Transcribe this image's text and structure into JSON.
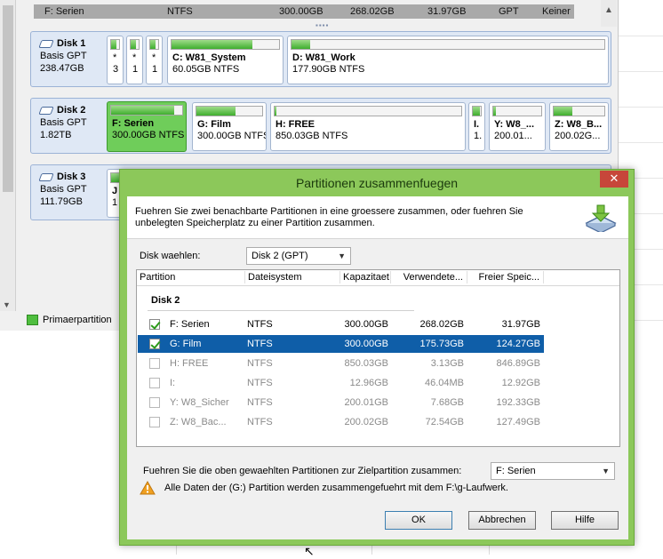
{
  "top_row": {
    "name": "F: Serien",
    "fs": "NTFS",
    "capacity": "300.00GB",
    "used": "268.02GB",
    "free": "31.97GB",
    "type": "GPT",
    "status": "Keiner"
  },
  "disks": [
    {
      "title": "Disk 1",
      "type": "Basis GPT",
      "size": "238.47GB",
      "partitions": [
        {
          "name": "*",
          "sub": "3",
          "fill": 0.7
        },
        {
          "name": "*",
          "sub": "1",
          "fill": 0.7
        },
        {
          "name": "*",
          "sub": "1",
          "fill": 0.7
        },
        {
          "name": "C: W81_System",
          "sub": "60.05GB NTFS",
          "fill": 0.75
        },
        {
          "name": "D: W81_Work",
          "sub": "177.90GB NTFS",
          "fill": 0.06
        }
      ]
    },
    {
      "title": "Disk 2",
      "type": "Basis GPT",
      "size": "1.82TB",
      "partitions": [
        {
          "name": "F: Serien",
          "sub": "300.00GB NTFS",
          "fill": 0.89,
          "selected": true
        },
        {
          "name": "G: Film",
          "sub": "300.00GB NTFS",
          "fill": 0.59
        },
        {
          "name": "H: FREE",
          "sub": "850.03GB NTFS",
          "fill": 0.01
        },
        {
          "name": "I.",
          "sub": "1.",
          "fill": 0.9
        },
        {
          "name": "Y: W8_...",
          "sub": "200.01...",
          "fill": 0.05
        },
        {
          "name": "Z: W8_B...",
          "sub": "200.02G...",
          "fill": 0.36
        }
      ]
    },
    {
      "title": "Disk 3",
      "type": "Basis GPT",
      "size": "111.79GB",
      "partitions": [
        {
          "name": "J",
          "sub": "1",
          "fill": 0.8
        }
      ]
    }
  ],
  "legend": {
    "label": "Primaerpartition",
    "color": "#4fbe3f"
  },
  "dialog": {
    "title": "Partitionen zusammenfuegen",
    "close": "✕",
    "description": "Fuehren Sie zwei benachbarte Partitionen in eine groessere zusammen, oder fuehren Sie unbelegten Speicherplatz zu einer Partition zusammen.",
    "disk_label": "Disk waehlen:",
    "disk_value": "Disk 2 (GPT)",
    "columns": [
      "Partition",
      "Dateisystem",
      "Kapazitaet",
      "Verwendete...",
      "Freier Speic..."
    ],
    "group": "Disk 2",
    "rows": [
      {
        "name": "F:  Serien",
        "fs": "NTFS",
        "cap": "300.00GB",
        "used": "268.02GB",
        "free": "31.97GB",
        "checked": true,
        "enabled": true,
        "highlight": false
      },
      {
        "name": "G:  Film",
        "fs": "NTFS",
        "cap": "300.00GB",
        "used": "175.73GB",
        "free": "124.27GB",
        "checked": true,
        "enabled": true,
        "highlight": true
      },
      {
        "name": "H:  FREE",
        "fs": "NTFS",
        "cap": "850.03GB",
        "used": "3.13GB",
        "free": "846.89GB",
        "checked": false,
        "enabled": false,
        "highlight": false
      },
      {
        "name": "I:",
        "fs": "NTFS",
        "cap": "12.96GB",
        "used": "46.04MB",
        "free": "12.92GB",
        "checked": false,
        "enabled": false,
        "highlight": false
      },
      {
        "name": "Y:  W8_Sicher",
        "fs": "NTFS",
        "cap": "200.01GB",
        "used": "7.68GB",
        "free": "192.33GB",
        "checked": false,
        "enabled": false,
        "highlight": false
      },
      {
        "name": "Z:  W8_Bac...",
        "fs": "NTFS",
        "cap": "200.02GB",
        "used": "72.54GB",
        "free": "127.49GB",
        "checked": false,
        "enabled": false,
        "highlight": false
      }
    ],
    "merge_label": "Fuehren Sie die oben gewaehlten Partitionen zur Zielpartition zusammen:",
    "merge_target": "F:  Serien",
    "warning": "Alle Daten der (G:) Partition werden zusammengefuehrt mit dem F:\\g-Laufwerk.",
    "buttons": {
      "ok": "OK",
      "cancel": "Abbrechen",
      "help": "Hilfe"
    }
  }
}
